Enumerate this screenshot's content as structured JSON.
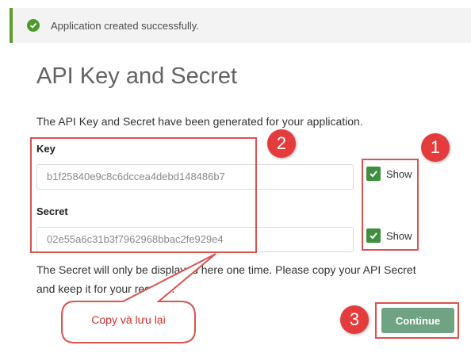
{
  "banner": {
    "message": "Application created successfully."
  },
  "page": {
    "title": "API Key and Secret",
    "description": "The API Key and Secret have been generated for your application."
  },
  "key": {
    "label": "Key",
    "value": "b1f25840e9c8c6dccea4debd148486b7",
    "show_label": "Show",
    "show_checked": true
  },
  "secret": {
    "label": "Secret",
    "value": "02e55a6c31b3f7962968bbac2fe929e4",
    "show_label": "Show",
    "show_checked": true
  },
  "note": "The Secret will only be displayed here one time. Please copy your API Secret and keep it for your records.",
  "continue_label": "Continue",
  "annotations": {
    "badge_1": "1",
    "badge_2": "2",
    "badge_3": "3",
    "callout": "Copy và lưu lại"
  },
  "colors": {
    "banner_accent": "#5f9a2e",
    "checkbox": "#3f8f3f",
    "continue_button": "#6fa384",
    "annotation_red": "#e43c3c"
  },
  "icons": {
    "banner": "check-circle-icon",
    "checkbox": "checkmark-icon"
  }
}
